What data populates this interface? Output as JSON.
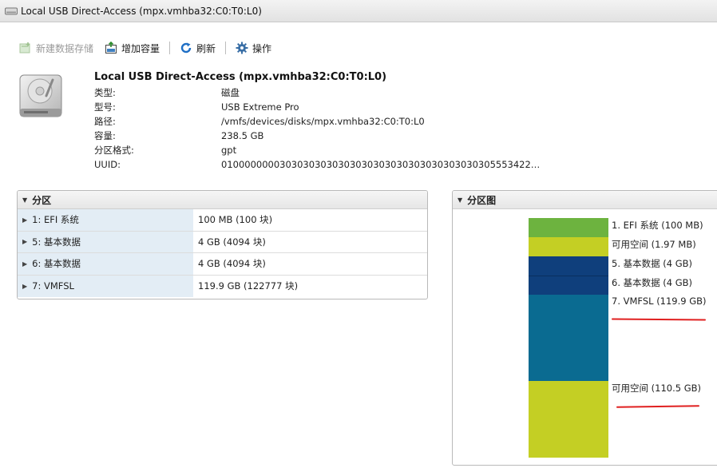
{
  "window": {
    "title": "Local USB Direct-Access (mpx.vmhba32:C0:T0:L0)"
  },
  "toolbar": {
    "new_datastore": "新建数据存储",
    "increase_capacity": "增加容量",
    "refresh": "刷新",
    "actions": "操作"
  },
  "device": {
    "title": "Local USB Direct-Access (mpx.vmhba32:C0:T0:L0)",
    "properties": [
      {
        "key": "类型:",
        "value": "磁盘"
      },
      {
        "key": "型号:",
        "value": "USB Extreme Pro"
      },
      {
        "key": "路径:",
        "value": "/vmfs/devices/disks/mpx.vmhba32:C0:T0:L0"
      },
      {
        "key": "容量:",
        "value": "238.5 GB"
      },
      {
        "key": "分区格式:",
        "value": "gpt"
      },
      {
        "key": "UUID:",
        "value": "01000000003030303030303030303030303030303030305553422…"
      }
    ]
  },
  "partitions": {
    "title": "分区",
    "rows": [
      {
        "name": "1: EFI 系统",
        "size": "100 MB (100 块)"
      },
      {
        "name": "5: 基本数据",
        "size": "4 GB (4094 块)"
      },
      {
        "name": "6: 基本数据",
        "size": "4 GB (4094 块)"
      },
      {
        "name": "7: VMFSL",
        "size": "119.9 GB (122777 块)"
      }
    ]
  },
  "partition_map": {
    "title": "分区图",
    "segments": [
      {
        "label": "1. EFI 系统  (100 MB)",
        "color": "#6db33f"
      },
      {
        "label": "可用空间  (1.97 MB)",
        "color": "#c4cf24"
      },
      {
        "label": "5. 基本数据  (4 GB)",
        "color": "#0f3f7c"
      },
      {
        "label": "6. 基本数据  (4 GB)",
        "color": "#0f3f7c"
      },
      {
        "label": "7. VMFSL  (119.9 GB)",
        "color": "#0a6b91"
      },
      {
        "label": "可用空间  (110.5 GB)",
        "color": "#c4cf24"
      }
    ]
  },
  "colors": {
    "annotation_red": "#e02020",
    "row_highlight": "#e3edf5"
  }
}
